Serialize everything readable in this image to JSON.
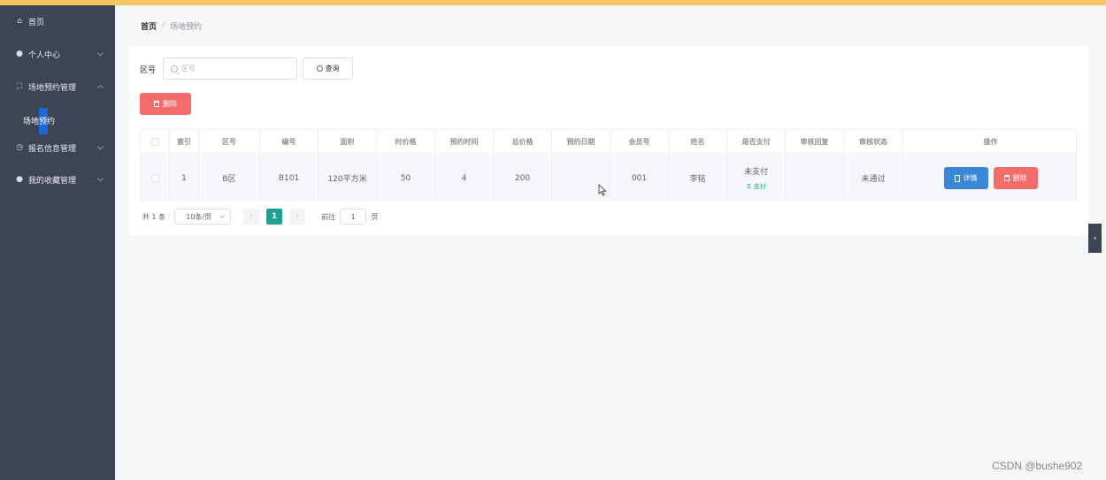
{
  "sidebar": {
    "items": [
      {
        "icon": "home-icon",
        "glyph": "⌂",
        "label": "首页"
      },
      {
        "icon": "user-icon",
        "glyph": "👤",
        "label": "个人中心",
        "expandable": true
      },
      {
        "icon": "venue-icon",
        "glyph": "⛶",
        "label": "场地预约管理",
        "expandable": true,
        "expanded": true
      },
      {
        "icon": "info-icon",
        "glyph": "◷",
        "label": "报名信息管理",
        "expandable": true
      },
      {
        "icon": "favorite-icon",
        "glyph": "👤",
        "label": "我的收藏管理",
        "expandable": true
      }
    ],
    "submenu": {
      "label": "场地预约"
    }
  },
  "breadcrumb": {
    "home": "首页",
    "separator": "/",
    "current": "场地预约"
  },
  "search": {
    "label": "区号",
    "placeholder": "区号",
    "button_label": "查询"
  },
  "toolbar": {
    "delete_label": "删除"
  },
  "table": {
    "columns": [
      "索引",
      "区号",
      "编号",
      "面积",
      "时价格",
      "预约时间",
      "总价格",
      "预约日期",
      "会员号",
      "姓名",
      "是否支付",
      "审核回复",
      "审核状态",
      "操作"
    ],
    "rows": [
      {
        "index": "1",
        "zone": "B区",
        "code": "B101",
        "area": "120平方米",
        "hour_price": "50",
        "book_time": "4",
        "total_price": "200",
        "book_date": "",
        "member_no": "001",
        "name": "李铭",
        "paid": "未支付",
        "pay_link": "支付",
        "reply": "",
        "status": "未通过",
        "detail_label": "详情",
        "delete_label": "删除"
      }
    ]
  },
  "pagination": {
    "total": "共 1 条",
    "page_size": "10条/页",
    "current_page": "1",
    "goto_prefix": "前往",
    "goto_value": "1",
    "goto_suffix": "页"
  },
  "watermark": "CSDN @bushe902",
  "colors": {
    "accent_top": "#f5c463",
    "sidebar_bg": "#3d4454",
    "danger": "#f56c6c",
    "primary": "#3a86d8",
    "page_active": "#1aa394"
  }
}
